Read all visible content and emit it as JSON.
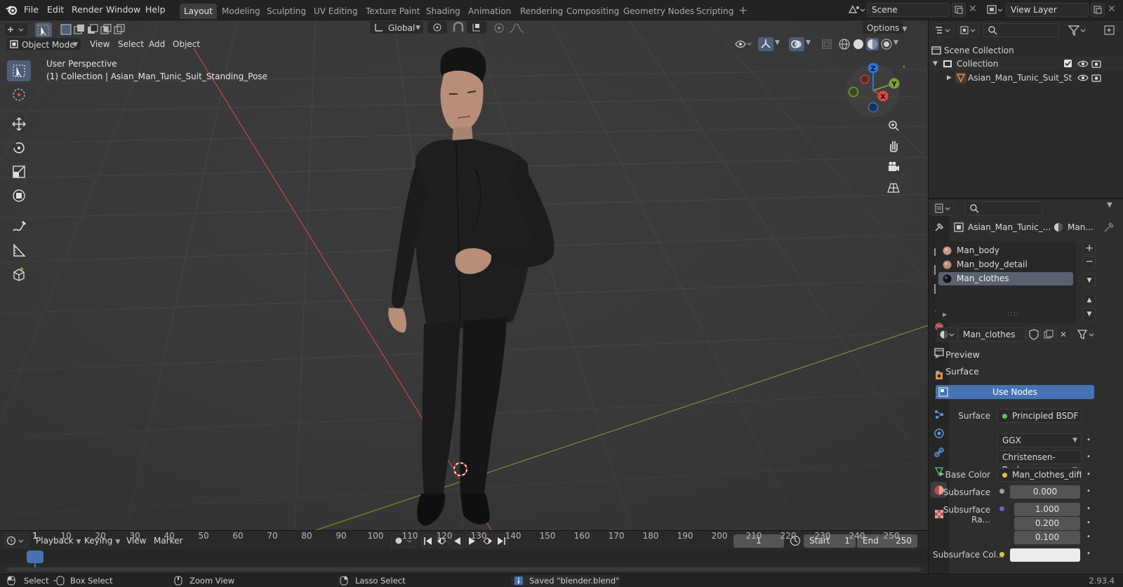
{
  "menu": {
    "file": "File",
    "edit": "Edit",
    "render": "Render",
    "window": "Window",
    "help": "Help"
  },
  "workspaces": [
    "Layout",
    "Modeling",
    "Sculpting",
    "UV Editing",
    "Texture Paint",
    "Shading",
    "Animation",
    "Rendering",
    "Compositing",
    "Geometry Nodes",
    "Scripting"
  ],
  "scene": {
    "scene_name": "Scene",
    "view_layer": "View Layer"
  },
  "viewport": {
    "mode": "Object Mode",
    "menus": [
      "View",
      "Select",
      "Add",
      "Object"
    ],
    "transform_orientation": "Global",
    "options": "Options",
    "overlay_title": "User Perspective",
    "overlay_subtitle": "(1) Collection | Asian_Man_Tunic_Suit_Standing_Pose",
    "gizmo": {
      "z": "Z",
      "y": "Y",
      "x": "X"
    }
  },
  "timeline": {
    "playback": "Playback",
    "keying": "Keying",
    "view": "View",
    "marker": "Marker",
    "current_frame": "1",
    "start_label": "Start",
    "start": "1",
    "end_label": "End",
    "end": "250",
    "ruler": [
      "1",
      "10",
      "20",
      "30",
      "40",
      "50",
      "60",
      "70",
      "80",
      "90",
      "100",
      "110",
      "120",
      "130",
      "140",
      "150",
      "160",
      "170",
      "180",
      "190",
      "200",
      "210",
      "220",
      "230",
      "240",
      "250"
    ]
  },
  "outliner": {
    "scene_collection": "Scene Collection",
    "collection": "Collection",
    "object": "Asian_Man_Tunic_Suit_St"
  },
  "properties": {
    "object_name": "Asian_Man_Tunic_...",
    "material_short": "Man...",
    "material_slots": [
      "Man_body",
      "Man_body_detail",
      "Man_clothes"
    ],
    "material_name": "Man_clothes",
    "preview": "Preview",
    "surface_panel": "Surface",
    "use_nodes": "Use Nodes",
    "surface_label": "Surface",
    "surface_value": "Principled BSDF",
    "distribution": "GGX",
    "subsurface_method": "Christensen-Burley",
    "base_color_label": "Base Color",
    "base_color_value": "Man_clothes_diffus...",
    "subsurface_label": "Subsurface",
    "subsurface_value": "0.000",
    "subsurface_radius_label": "Subsurface Ra...",
    "subsurface_radius": [
      "1.000",
      "0.200",
      "0.100"
    ],
    "subsurface_color_label": "Subsurface Col..."
  },
  "statusbar": {
    "select": "Select",
    "box_select": "Box Select",
    "zoom_view": "Zoom View",
    "lasso_select": "Lasso Select",
    "message": "Saved \"blender.blend\"",
    "version": "2.93.4"
  },
  "colors": {
    "accent": "#4772b3",
    "active_tool": "#4e5d78",
    "x_axis": "#c64747",
    "y_axis": "#7ea233",
    "z_axis": "#2f73e0"
  }
}
